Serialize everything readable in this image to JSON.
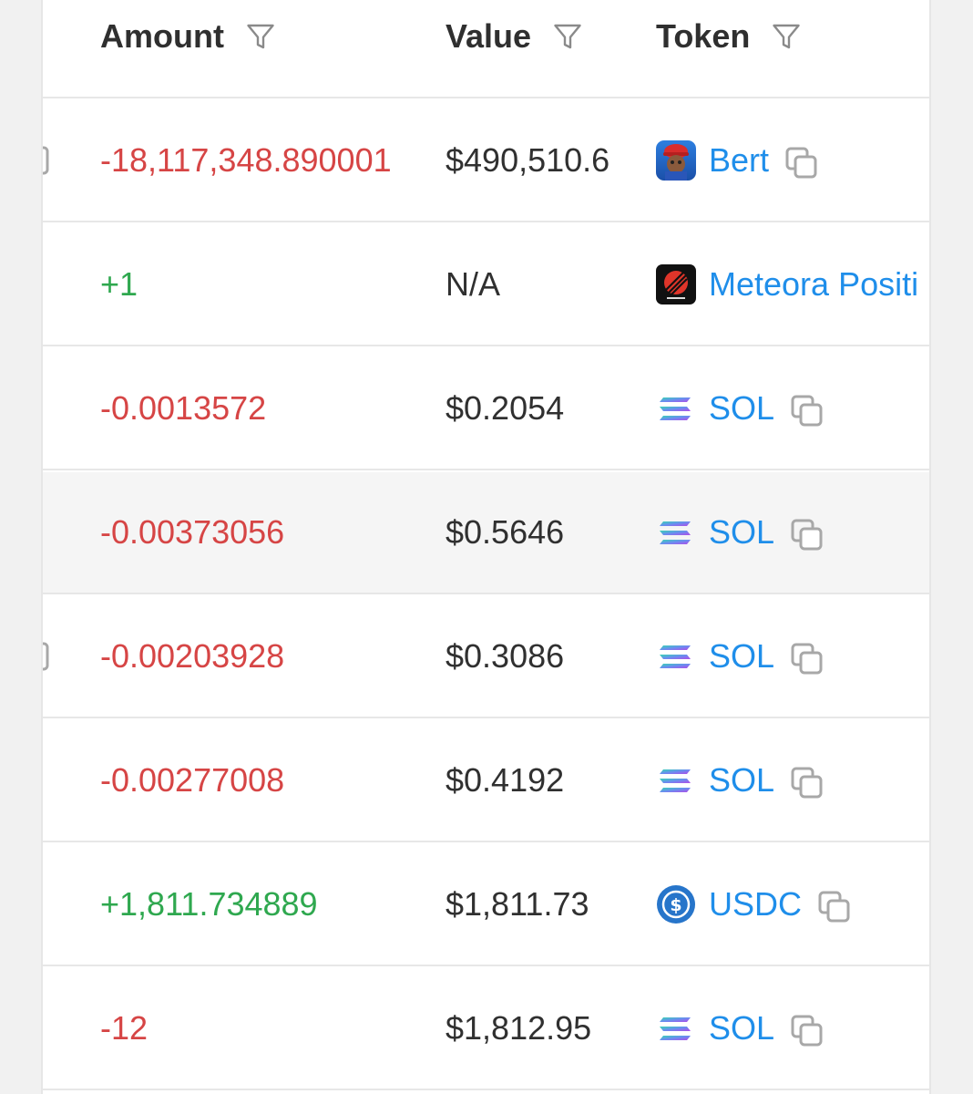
{
  "table": {
    "columns": [
      {
        "label": "Amount"
      },
      {
        "label": "Value"
      },
      {
        "label": "Token"
      }
    ],
    "rows": [
      {
        "amount": "-18,117,348.890001",
        "amount_sign": "neg",
        "value": "$490,510.6",
        "token": "Bert",
        "token_icon": "bert-icon",
        "copy": true,
        "left_copy": true
      },
      {
        "amount": "+1",
        "amount_sign": "pos",
        "value": "N/A",
        "token": "Meteora Positi",
        "token_icon": "meteora-icon",
        "copy": false,
        "left_copy": false
      },
      {
        "amount": "-0.0013572",
        "amount_sign": "neg",
        "value": "$0.2054",
        "token": "SOL",
        "token_icon": "solana-icon",
        "copy": true,
        "left_copy": false
      },
      {
        "amount": "-0.00373056",
        "amount_sign": "neg",
        "value": "$0.5646",
        "token": "SOL",
        "token_icon": "solana-icon",
        "copy": true,
        "left_copy": false
      },
      {
        "amount": "-0.00203928",
        "amount_sign": "neg",
        "value": "$0.3086",
        "token": "SOL",
        "token_icon": "solana-icon",
        "copy": true,
        "left_copy": true
      },
      {
        "amount": "-0.00277008",
        "amount_sign": "neg",
        "value": "$0.4192",
        "token": "SOL",
        "token_icon": "solana-icon",
        "copy": true,
        "left_copy": false
      },
      {
        "amount": "+1,811.734889",
        "amount_sign": "pos",
        "value": "$1,811.73",
        "token": "USDC",
        "token_icon": "usdc-icon",
        "copy": true,
        "left_copy": false
      },
      {
        "amount": "-12",
        "amount_sign": "neg",
        "value": "$1,812.95",
        "token": "SOL",
        "token_icon": "solana-icon",
        "copy": true,
        "left_copy": false
      }
    ]
  },
  "colors": {
    "negative": "#d64545",
    "positive": "#2fa84f",
    "link": "#1f8eea",
    "highlight_row": "#f5f5f5"
  }
}
